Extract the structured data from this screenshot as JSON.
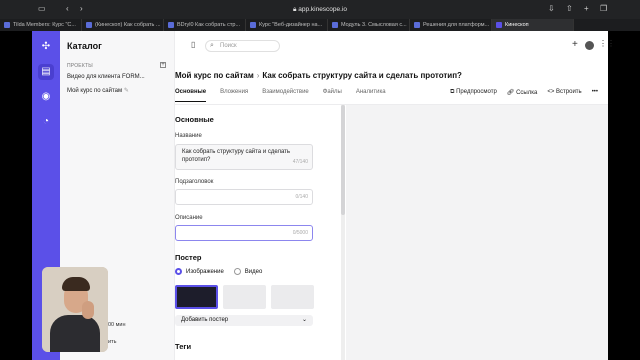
{
  "browser": {
    "url": "app.kinescope.io",
    "tabs": [
      {
        "label": "Tilda Members: Курс \"С...",
        "active": false
      },
      {
        "label": "(Кинескоп) Как собрать ...",
        "active": false
      },
      {
        "label": "​BDryl0 Как собрать стр...",
        "active": false
      },
      {
        "label": "Курс \"Веб-дизайнер на...",
        "active": false
      },
      {
        "label": "Модуль 3. Смысловая с...",
        "active": false
      },
      {
        "label": "Решения для платформ...",
        "active": false
      },
      {
        "label": "Кинескоп",
        "active": true
      }
    ]
  },
  "catalog": {
    "title": "Каталог",
    "projects_label": "ПРОЕКТЫ",
    "add_symbol": "+",
    "projects": [
      "Видео для клиента FORM...",
      "Мой курс по сайтам"
    ]
  },
  "topbar": {
    "search_placeholder": "Поиск"
  },
  "breadcrumb": {
    "parent": "Мой курс по сайтам",
    "separator": "›",
    "current": "Как собрать структуру сайта и сделать прототип?"
  },
  "tabs": [
    "Основные",
    "Вложения",
    "Взаимодействие",
    "Файлы",
    "Аналитика"
  ],
  "actions": {
    "preview": "Предпросмотр",
    "link": "Ссылка",
    "embed": "Встроить",
    "more": "•••"
  },
  "form": {
    "section_title": "Основные",
    "name_label": "Название",
    "name_value": "Как собрать структуру сайта и сделать прототип?",
    "name_counter": "47/140",
    "subtitle_label": "Подзаголовок",
    "subtitle_counter": "0/140",
    "description_label": "Описание",
    "description_counter": "0/5000",
    "poster_title": "Постер",
    "poster_option_image": "Изображение",
    "poster_option_video": "Видео",
    "add_poster": "Добавить постер",
    "tags_title": "Теги"
  },
  "cam_side": {
    "line1": "00 мин",
    "line2": "ить"
  }
}
